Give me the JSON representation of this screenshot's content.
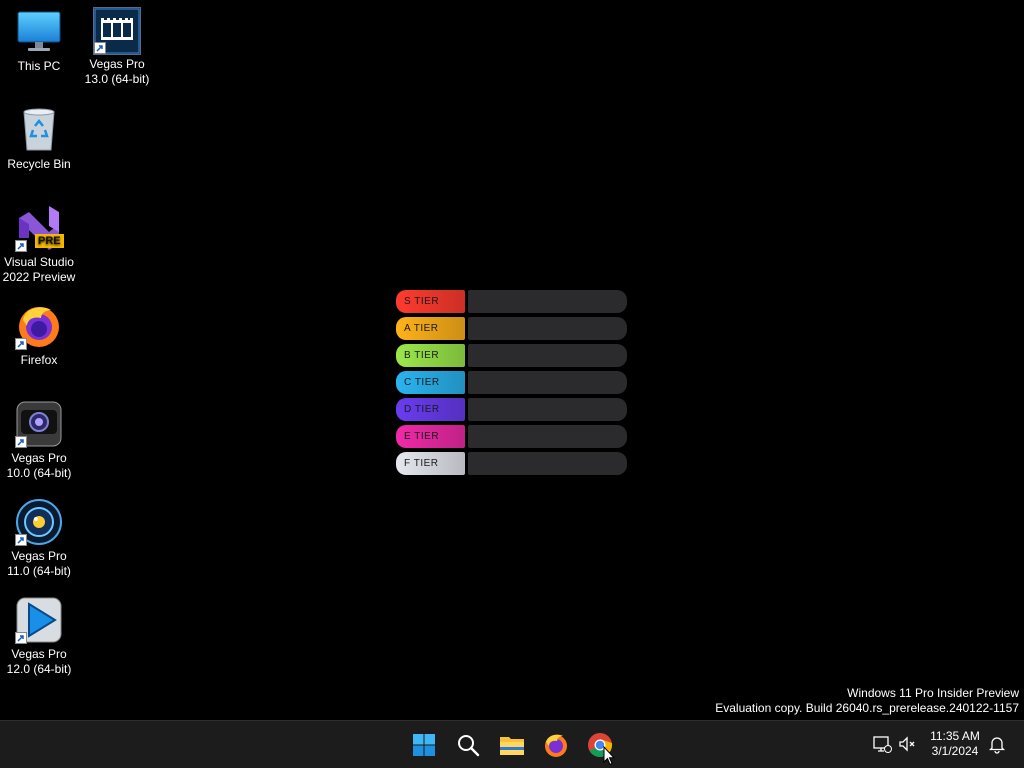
{
  "desktop": {
    "icons": [
      {
        "label_line1": "This PC",
        "label_line2": ""
      },
      {
        "label_line1": "Vegas Pro",
        "label_line2": "13.0 (64-bit)"
      },
      {
        "label_line1": "Recycle Bin",
        "label_line2": ""
      },
      {
        "label_line1": "Visual Studio",
        "label_line2": "2022 Preview",
        "badge": "PRE"
      },
      {
        "label_line1": "Firefox",
        "label_line2": ""
      },
      {
        "label_line1": "Vegas Pro",
        "label_line2": "10.0 (64-bit)"
      },
      {
        "label_line1": "Vegas Pro",
        "label_line2": "11.0 (64-bit)"
      },
      {
        "label_line1": "Vegas Pro",
        "label_line2": "12.0 (64-bit)"
      }
    ]
  },
  "wallpaper": {
    "tiers": [
      {
        "label": "S  TIER",
        "color": "#ff3b2f"
      },
      {
        "label": "A  TIER",
        "color": "#ffb21a"
      },
      {
        "label": "B  TIER",
        "color": "#9be84a"
      },
      {
        "label": "C  TIER",
        "color": "#2ab4f0"
      },
      {
        "label": "D  TIER",
        "color": "#6a3cf0"
      },
      {
        "label": "E  TIER",
        "color": "#f02aa8"
      },
      {
        "label": "F  TIER",
        "color": "#e6e8f0"
      }
    ]
  },
  "watermark": {
    "line1": "Windows 11 Pro Insider Preview",
    "line2": "Evaluation copy. Build 26040.rs_prerelease.240122-1157"
  },
  "taskbar": {
    "apps": [
      "start-icon",
      "search-icon",
      "file-explorer-icon",
      "firefox-icon",
      "chrome-icon"
    ],
    "clock": {
      "time": "11:35 AM",
      "date": "3/1/2024"
    }
  }
}
